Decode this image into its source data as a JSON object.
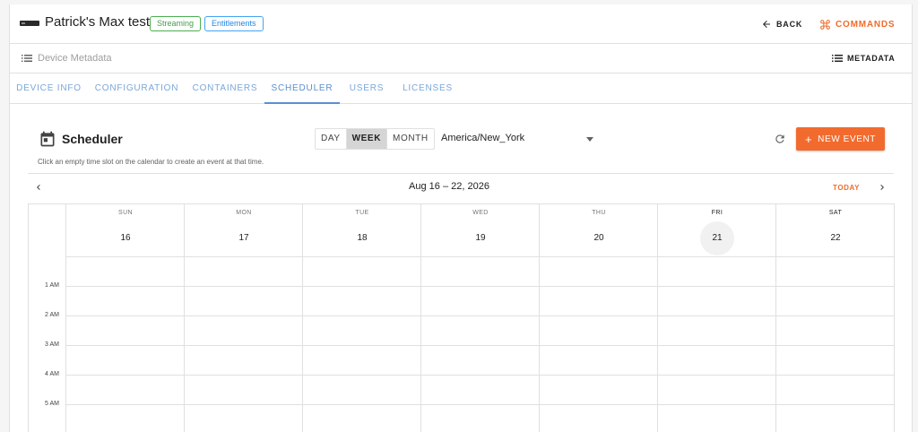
{
  "header": {
    "title": "Patrick's Max test",
    "chips": {
      "streaming": "Streaming",
      "entitlements": "Entitlements"
    },
    "back_label": "BACK",
    "commands_label": "COMMANDS",
    "accent_color": "#ef6c2c"
  },
  "metabar": {
    "left_label": "Device Metadata",
    "right_label": "METADATA"
  },
  "tabs": [
    {
      "label": "DEVICE INFO"
    },
    {
      "label": "CONFIGURATION"
    },
    {
      "label": "CONTAINERS"
    },
    {
      "label": "SCHEDULER",
      "active": true
    },
    {
      "label": "USERS"
    },
    {
      "label": "LICENSES"
    }
  ],
  "scheduler": {
    "title": "Scheduler",
    "hint": "Click an empty time slot on the calendar to create an event at that time.",
    "views": [
      "DAY",
      "WEEK",
      "MONTH"
    ],
    "active_view": "WEEK",
    "timezone": "America/New_York",
    "new_event_label": "NEW EVENT"
  },
  "calendar": {
    "range": "Aug 16 – 22, 2026",
    "today_label": "TODAY",
    "days": [
      {
        "dow": "SUN",
        "date": "16"
      },
      {
        "dow": "MON",
        "date": "17"
      },
      {
        "dow": "TUE",
        "date": "18"
      },
      {
        "dow": "WED",
        "date": "19"
      },
      {
        "dow": "THU",
        "date": "20"
      },
      {
        "dow": "FRI",
        "date": "21",
        "current": true
      },
      {
        "dow": "SAT",
        "date": "22"
      }
    ],
    "hours": [
      "1 AM",
      "2 AM",
      "3 AM",
      "4 AM",
      "5 AM"
    ]
  }
}
